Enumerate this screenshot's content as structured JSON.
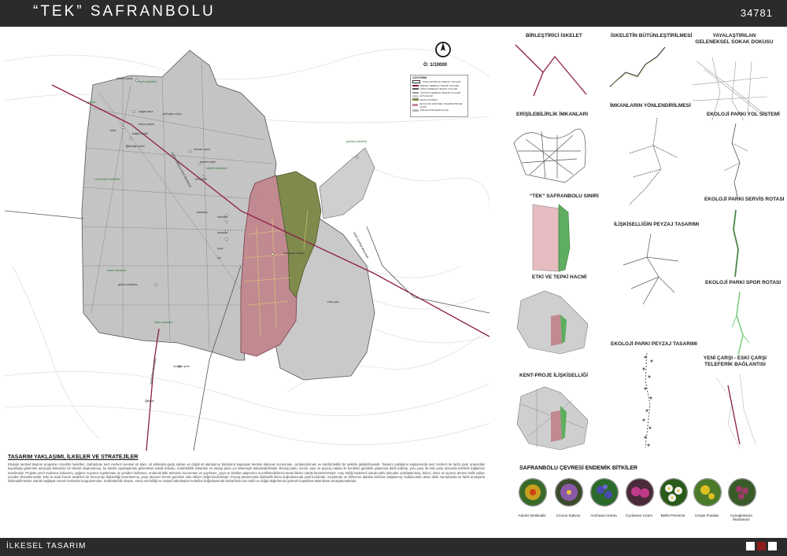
{
  "header": {
    "title": "“TEK” SAFRANBOLU",
    "code": "34781"
  },
  "footer": {
    "label": "İLKESEL TASARIM",
    "squares": [
      "#ffffff",
      "#8c1c1c",
      "#ffffff"
    ]
  },
  "map": {
    "scale": "Ö: 1/10000",
    "compass": "north-arrow",
    "legend": {
      "title": "GÖSTERİM",
      "items": [
        {
          "label": "YAYALAŞTIRILAN TRAFİK YOLLARI",
          "color": "#ffffff"
        },
        {
          "label": "BİRİNCİ DERECE TRAFİK YOLLARI",
          "color": "#8c1c4c"
        },
        {
          "label": "İKİNCİ DERECE TRAFİK YOLLARI",
          "color": "#555555"
        },
        {
          "label": "ÜÇÜNCÜ DERECE TRAFİK YOLLARI",
          "color": "#999999"
        },
        {
          "label": "ETKİ ALANI",
          "color": "#cccccc"
        },
        {
          "label": "EKOLOJİ PARKI",
          "color": "#7a8a4a"
        },
        {
          "label": "EKOLOJİK KENTSEL TASARIM PROJE ALANI",
          "color": "#c08a90"
        },
        {
          "label": "PROJE ETİKLEŞİM ALANI",
          "color": "#bbbbbb"
        }
      ]
    },
    "labels": [
      {
        "text": "tülbent sokak",
        "green": false
      },
      {
        "text": "şeyh mahallesi",
        "green": true
      },
      {
        "text": "bağlar sana",
        "green": false
      },
      {
        "text": "zafi tuğan okulu",
        "green": false
      },
      {
        "text": "çarşılar",
        "green": true
      },
      {
        "text": "tekel",
        "green": false
      },
      {
        "text": "bahar çarşısı",
        "green": false
      },
      {
        "text": "bağlar bucak",
        "green": false
      },
      {
        "text": "dedeoğlu camii",
        "green": false
      },
      {
        "text": "merkez camii",
        "green": false
      },
      {
        "text": "merkez parkı",
        "green": false
      },
      {
        "text": "gümüş mahallesi",
        "green": true
      },
      {
        "text": "ahmediye",
        "green": false
      },
      {
        "text": "atatürk mahallesi",
        "green": true
      },
      {
        "text": "cumhuriyet mahallesi",
        "green": true
      },
      {
        "text": "emek mahallesi",
        "green": true
      },
      {
        "text": "bararkay",
        "green": false
      },
      {
        "text": "belediye",
        "green": false
      },
      {
        "text": "anadolu",
        "green": false
      },
      {
        "text": "çarşı",
        "green": false
      },
      {
        "text": "hal",
        "green": false
      },
      {
        "text": "gülüm ortaokulu",
        "green": false
      },
      {
        "text": "karapazar sanayi",
        "green": false
      },
      {
        "text": "eski çarşı",
        "green": false
      },
      {
        "text": "baklı mahallesi",
        "green": true
      },
      {
        "text": "osmanlı şehir",
        "green": false
      },
      {
        "text": "vilayet",
        "green": false
      },
      {
        "text": "SAFRANBOLU ESKİ MERKEZİ",
        "green": false
      },
      {
        "text": "ESKİ ÇARIŞI BULVARI",
        "green": false
      },
      {
        "text": "KARABUK BULVARI",
        "green": false
      }
    ]
  },
  "diagrams": [
    {
      "title": "BİRLEŞTİRİCİ İSKELET"
    },
    {
      "title": "İSKELETİN BÜTÜNLEŞTİRİLMESİ"
    },
    {
      "title": "YAYALAŞTIRILAN GELENEKSEL SOKAK DOKUSU"
    },
    {
      "title": "ERİŞİLEBİLİRLİK İMKANLARI"
    },
    {
      "title": "İMKANLARIN YÖNLENDİRİLMESİ"
    },
    {
      "title": "EKOLOJİ PARKI YOL SİSTEMİ"
    },
    {
      "title": "“TEK” SAFRANBOLU SINIRI"
    },
    {
      "title": "EKOLOJİ PARKI SERVİS ROTASI"
    },
    {
      "title": "İLİŞKİSELLİĞİN PEYZAJ TASARIMI"
    },
    {
      "title": "ETKİ VE TEPKİ HACMİ"
    },
    {
      "title": "EKOLOJİ PARKI SPOR ROTASI"
    },
    {
      "title": "EKOLOJİ PARKI PEYZAJ TASARIMI"
    },
    {
      "title": "KENT-PROJE İLİŞKİSELLİĞİ"
    },
    {
      "title": "YENİ ÇARŞI - ESKİ ÇARŞI TELEFERİK BAĞLANTISI"
    }
  ],
  "approach": {
    "title": "TASARIM YAKLAŞIMI, İLKELER VE STRATEJİLER",
    "text": "Ekolojik kentsel tasarım projesinin öncelikli hedefleri, Safranbolu kent merkezi kentsel sit alanı, sit etkileşim-geçiş sahası ve doğal sit alanlarının bütününü kapsayan kentsel dokunun korunması, canlandırılması ve sürdürülebilir bir şekilde geliştirilmesidir. Tasarım yaklaşımı kapsamında kent merkezi ile tarihi çarşı arasındaki kopukluğu gidermek amacıyla birleştirici bir iskelet oluşturulmuş, bu iskelet yayalaştırılan geleneksel sokak dokusu, erişilebilirlik imkanları ve ekoloji parkı yol sistemiyle bütünleştirilmiştir. Ekoloji parkı; servis, spor ve peyzaj rotaları ile kentlinin gündelik yaşamına dahil edilmiş, yeni çarşı ile eski çarşı arasında teleferik bağlantısı önerilmiştir. Projede yerel malzeme kullanımı, yağmur suyunun toplanması ve yeniden kullanımı, endemik bitki türlerinin korunması ve yayılması, yaya ve bisiklet ulaşımının önceliklendirilmesi temel ilkeler olarak benimsenmiştir. Araç trafiği kademeli olarak tarihi dokudan uzaklaştırılmış, birinci, ikinci ve üçüncü derece trafik yolları yeniden düzenlenmiştir. Etki ve tepki hacmi analizleri ile kent-proje ilişkiselliği tanımlanmış, proje alanının kentin geneline olan etkileri değerlendirilmiştir. Peyzaj tasarımında ilişkisellik ilkesi doğrultusunda yeşil koridorlar, meydanlar ve dinlenme alanları birbirine bağlanmış; kullanıcıların alanı farklı zamanlarda ve farklı amaçlarla kullanabilmesine olanak sağlayan esnek mekanlar kurgulanmıştır. Sürdürülebilir ulaşım, enerji verimliliği ve sosyal bütünleşme hedefleri doğrultusunda Safranbolu’nun tarihi ve doğal değerlerinin gelecek kuşaklara aktarılması amaçlanmaktadır."
  },
  "plants": {
    "title": "SAFRANBOLU ÇEVRESİ ENDEMİK BİTKİLER",
    "items": [
      {
        "name": "Adonis Destivalis",
        "color": "#c8a020",
        "center": "#d04010"
      },
      {
        "name": "Crocus Sativus",
        "color": "#8a5aa8",
        "center": "#e8c040"
      },
      {
        "name": "Anchusa Azurea",
        "color": "#4a4ab0",
        "center": "#2a6a2a"
      },
      {
        "name": "Cyclamen Coum",
        "color": "#c03a8a",
        "center": "#4a2a3a"
      },
      {
        "name": "Bellis Perennis",
        "color": "#f0f0f0",
        "center": "#2a5a1a"
      },
      {
        "name": "Crepis Foetida",
        "color": "#e0c020",
        "center": "#4a7a2a"
      },
      {
        "name": "Cynoglossum Montanum",
        "color": "#a03a6a",
        "center": "#3a5a2a"
      }
    ]
  }
}
